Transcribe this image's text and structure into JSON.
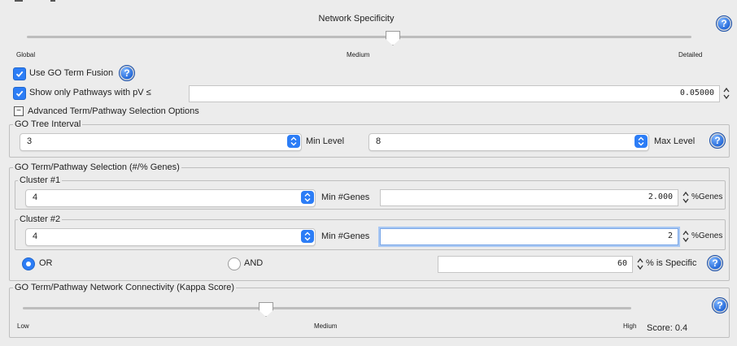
{
  "specificity": {
    "title": "Network Specificity",
    "labels": {
      "left": "Global",
      "mid": "Medium",
      "right": "Detailed"
    },
    "level": 0.5
  },
  "options": {
    "go_fusion": {
      "label": "Use GO Term Fusion",
      "checked": true
    },
    "pv_filter": {
      "label": "Show only Pathways with pV ≤",
      "checked": true,
      "value": "0.05000"
    },
    "advanced": {
      "label": "Advanced Term/Pathway Selection Options",
      "symbol": "−"
    }
  },
  "tree_interval": {
    "title": "GO Tree Interval",
    "min_value": "3",
    "min_label": "Min Level",
    "max_value": "8",
    "max_label": "Max Level"
  },
  "selection": {
    "title": "GO Term/Pathway Selection (#/% Genes)",
    "clusters": [
      {
        "title": "Cluster #1",
        "min_genes": "4",
        "min_label": "Min #Genes",
        "percent": "2.000",
        "percent_label": "%Genes"
      },
      {
        "title": "Cluster #2",
        "min_genes": "4",
        "min_label": "Min #Genes",
        "percent": "2",
        "percent_label": "%Genes"
      }
    ],
    "logic": {
      "or_label": "OR",
      "and_label": "AND",
      "selected": "OR"
    },
    "specific": {
      "value": "60",
      "label": "% is Specific"
    }
  },
  "kappa": {
    "title": "GO Term/Pathway Network Connectivity (Kappa Score)",
    "labels": {
      "low": "Low",
      "mid": "Medium",
      "high": "High"
    },
    "score_text": "Score: 0.4",
    "level": 0.4
  },
  "help_symbol": "?",
  "colors": {
    "accent": "#2c7df6",
    "help": "#1d63d6"
  }
}
